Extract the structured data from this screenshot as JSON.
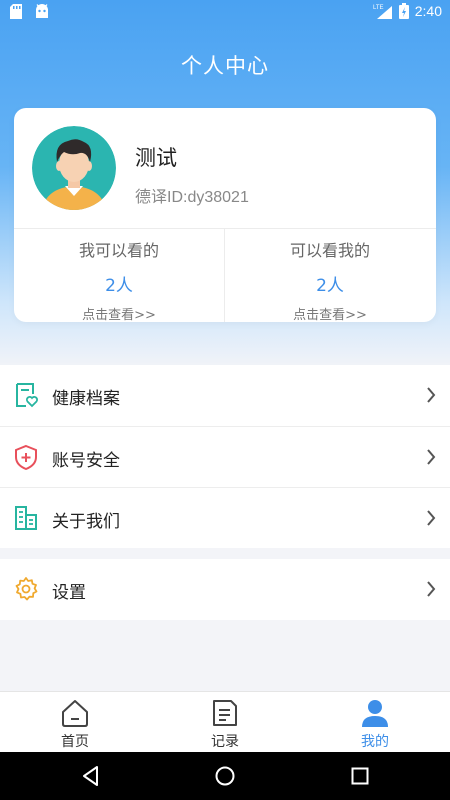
{
  "status_bar": {
    "time": "2:40",
    "network": "LTE"
  },
  "header": {
    "title": "个人中心"
  },
  "profile": {
    "name": "测试",
    "id_text": "德译ID:dy38021"
  },
  "stats": [
    {
      "title": "我可以看的",
      "count": "2人",
      "link": "点击查看>>"
    },
    {
      "title": "可以看我的",
      "count": "2人",
      "link": "点击查看>>"
    }
  ],
  "menu": {
    "group1": [
      {
        "label": "健康档案",
        "icon": "health-record-icon",
        "color": "#27b5a0"
      },
      {
        "label": "账号安全",
        "icon": "shield-icon",
        "color": "#e8505b"
      },
      {
        "label": "关于我们",
        "icon": "building-icon",
        "color": "#27b5a0"
      }
    ],
    "group2": [
      {
        "label": "设置",
        "icon": "gear-icon",
        "color": "#f0a92e"
      }
    ]
  },
  "tabs": [
    {
      "label": "首页",
      "icon": "home-icon",
      "active": false
    },
    {
      "label": "记录",
      "icon": "record-icon",
      "active": false
    },
    {
      "label": "我的",
      "icon": "user-icon",
      "active": true
    }
  ],
  "colors": {
    "accent": "#3d8ee8",
    "header_gradient_top": "#4aa2f2",
    "teal": "#27b5a0",
    "red": "#e8505b",
    "orange": "#f0a92e"
  }
}
